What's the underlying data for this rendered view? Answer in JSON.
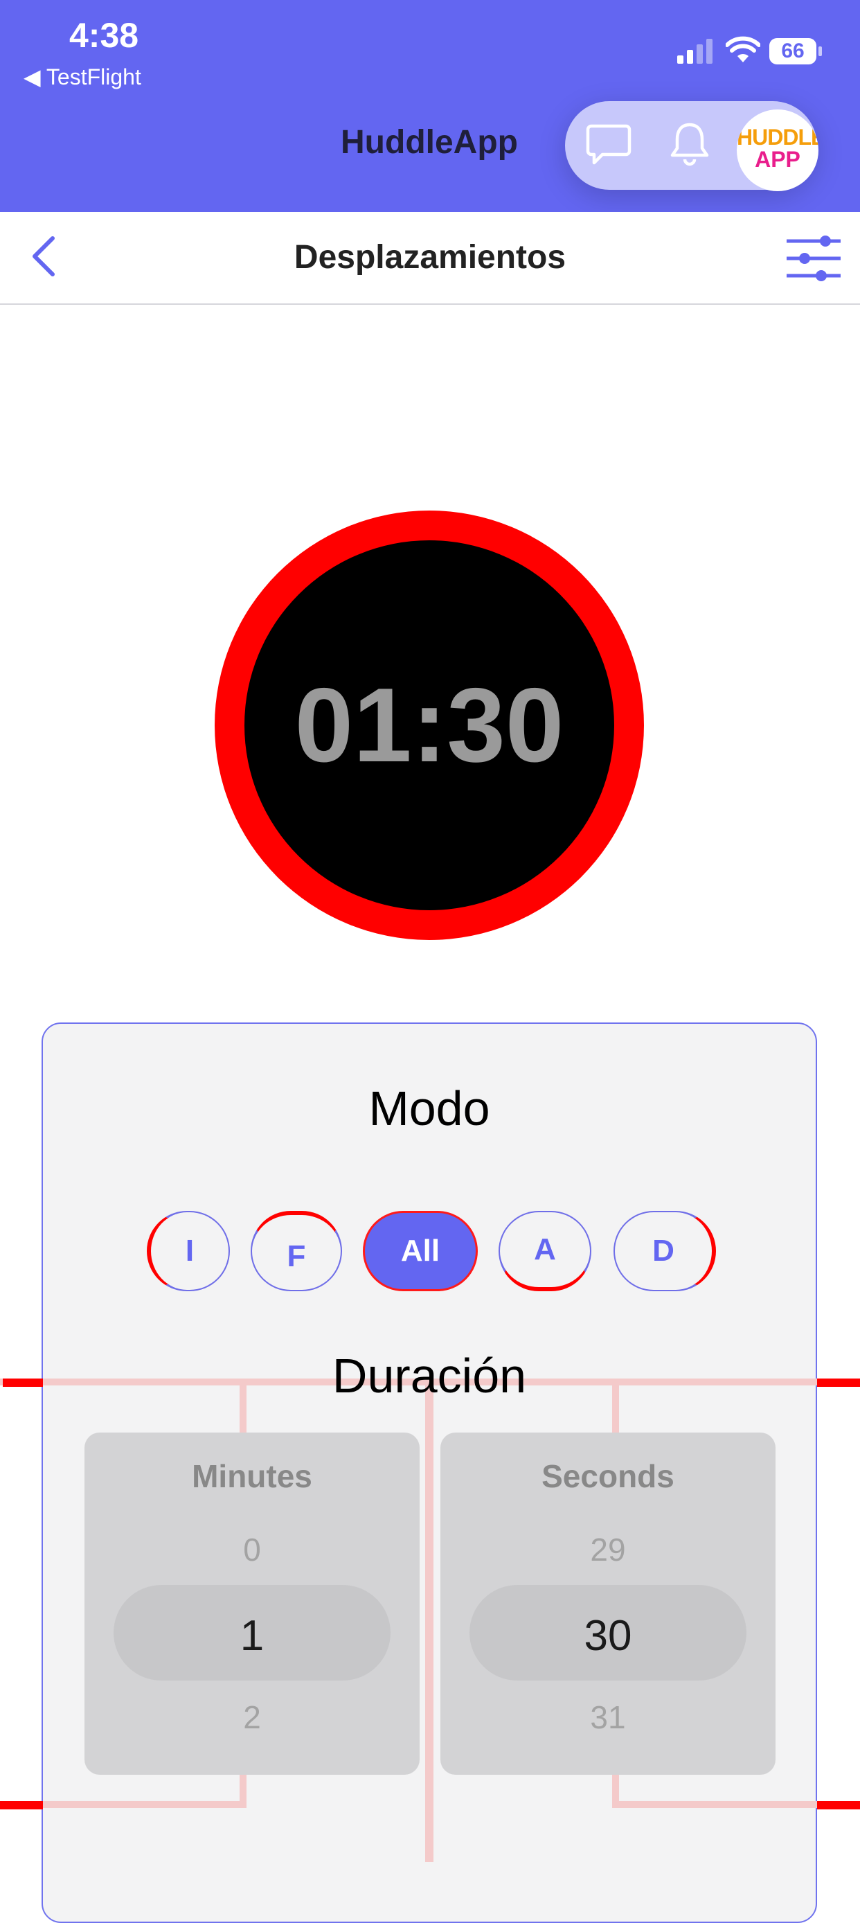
{
  "status_bar": {
    "time": "4:38",
    "back_app": "◀ TestFlight",
    "battery": "66",
    "icons": [
      "signal-icon",
      "wifi-icon",
      "battery-icon"
    ]
  },
  "header": {
    "title": "HuddleApp",
    "icons": [
      "chat-icon",
      "bell-icon"
    ],
    "logo_line1": "HUDDLE",
    "logo_line2": "APP"
  },
  "nav": {
    "title": "Desplazamientos",
    "icons": [
      "back-chevron-icon",
      "filter-sliders-icon"
    ]
  },
  "timer": {
    "display": "01:30"
  },
  "settings": {
    "mode_label": "Modo",
    "modes": [
      "I",
      "F",
      "All",
      "A",
      "D"
    ],
    "selected_mode": "All",
    "duration_label": "Duración",
    "minutes_picker": {
      "title": "Minutes",
      "prev": "0",
      "current": "1",
      "next": "2"
    },
    "seconds_picker": {
      "title": "Seconds",
      "prev": "29",
      "current": "30",
      "next": "31"
    }
  },
  "colors": {
    "brand": "#6366f1",
    "timer_ring": "#ff0000",
    "timer_face": "#000000",
    "card_bg": "#f3f3f4"
  }
}
